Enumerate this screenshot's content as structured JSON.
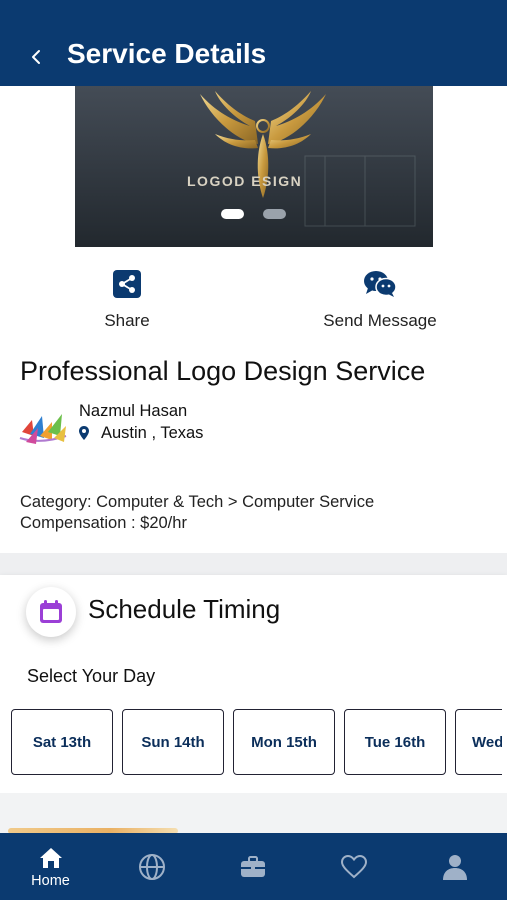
{
  "header": {
    "title": "Service Details"
  },
  "banner": {
    "logo_text": "LOGOD ESIGN"
  },
  "actions": {
    "share_label": "Share",
    "message_label": "Send Message"
  },
  "service": {
    "title": "Professional Logo Design Service",
    "seller_name": "Nazmul Hasan",
    "location": "Austin , Texas",
    "category": "Category: Computer & Tech >  Computer Service",
    "compensation": "Compensation : $20/hr"
  },
  "schedule": {
    "title": "Schedule Timing",
    "select_label": "Select Your Day",
    "days": [
      "Sat 13th",
      "Sun 14th",
      "Mon 15th",
      "Tue 16th",
      "Wed"
    ]
  },
  "tabbar": {
    "home_label": "Home"
  },
  "colors": {
    "primary": "#0b3a70",
    "accent_purple": "#9b3fd6",
    "gold": "#d9b25a"
  }
}
